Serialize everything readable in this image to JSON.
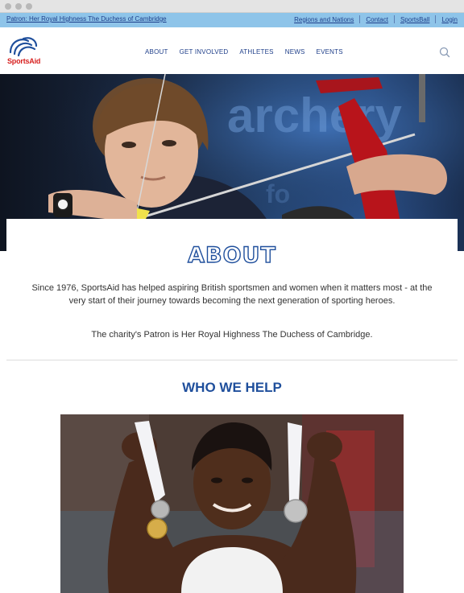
{
  "topbar": {
    "patron": "Patron: Her Royal Highness The Duchess of Cambridge",
    "links": [
      "Regions and Nations",
      "Contact",
      "SportsBall",
      "Login"
    ]
  },
  "header": {
    "logo_text": "SportsAid",
    "nav": [
      "ABOUT",
      "GET INVOLVED",
      "ATHLETES",
      "NEWS",
      "EVENTS"
    ],
    "search_icon": "search-icon"
  },
  "hero": {
    "banner_text": "archery"
  },
  "about": {
    "title": "ABOUT",
    "paragraph1": "Since 1976, SportsAid has helped aspiring British sportsmen and women when it matters most - at the very start of their journey towards becoming the next generation of sporting heroes.",
    "paragraph2": "The charity's Patron is Her Royal Highness The Duchess of Cambridge."
  },
  "who_we_help": {
    "title": "WHO WE HELP"
  },
  "colors": {
    "brand_blue": "#1f4f9c",
    "topbar_blue": "#8ec4e9",
    "brand_red": "#d7201f"
  }
}
